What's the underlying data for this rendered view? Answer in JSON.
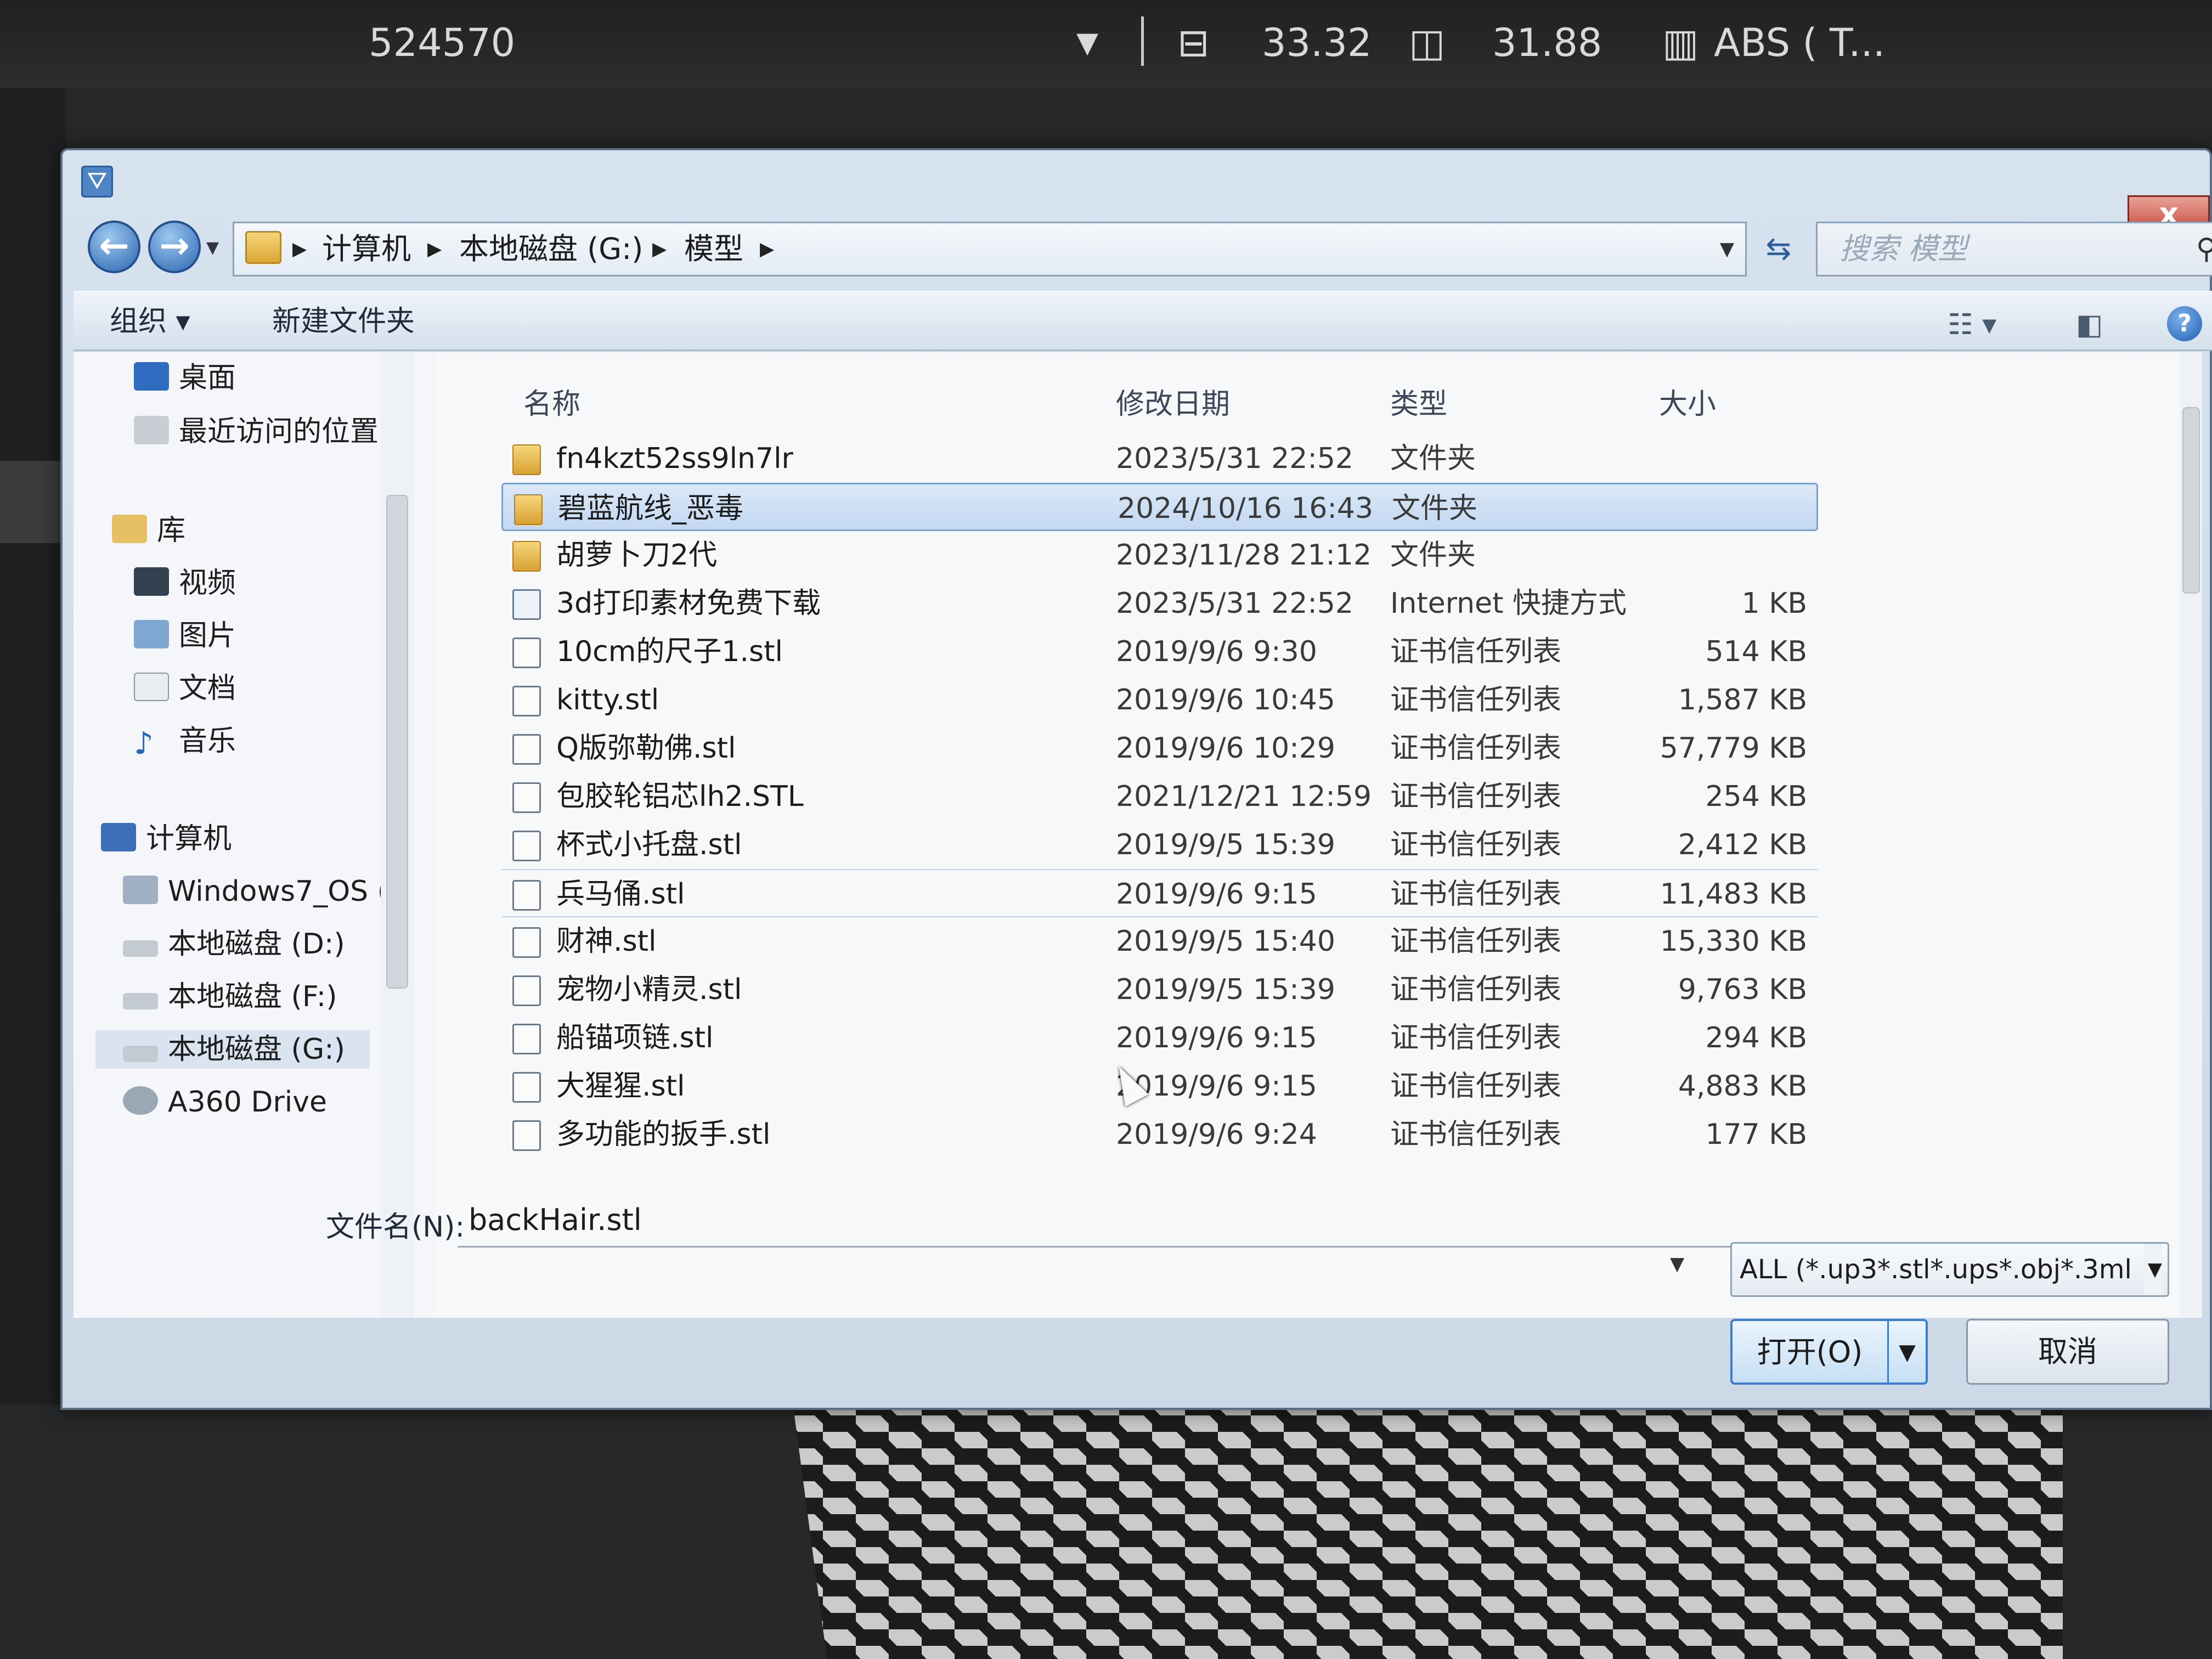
{
  "topbar": {
    "id_text": "524570",
    "dropdown_icon": "▼",
    "nozzle_temp": "33.32",
    "bed_temp": "31.88",
    "material": "ABS ( T..."
  },
  "dialog": {
    "title_icon": "filter-icon",
    "close_label": "x",
    "breadcrumb": [
      "计算机",
      "本地磁盘 (G:)",
      "模型"
    ],
    "search_placeholder": "搜索 模型",
    "toolbar": {
      "organize": "组织 ▾",
      "new_folder": "新建文件夹"
    },
    "nav": {
      "favorites": [
        "桌面",
        "最近访问的位置"
      ],
      "library_label": "库",
      "libraries": [
        "视频",
        "图片",
        "文档",
        "音乐"
      ],
      "computer_label": "计算机",
      "drives": [
        "Windows7_OS (",
        "本地磁盘 (D:)",
        "本地磁盘 (F:)",
        "本地磁盘 (G:)",
        "A360 Drive"
      ]
    },
    "columns": {
      "name": "名称",
      "date": "修改日期",
      "type": "类型",
      "size": "大小"
    },
    "files": [
      {
        "name": "fn4kzt52ss9ln7lr",
        "date": "2023/5/31 22:52",
        "type": "文件夹",
        "size": "",
        "kind": "folder"
      },
      {
        "name": "碧蓝航线_恶毒",
        "date": "2024/10/16 16:43",
        "type": "文件夹",
        "size": "",
        "kind": "folder"
      },
      {
        "name": "胡萝卜刀2代",
        "date": "2023/11/28 21:12",
        "type": "文件夹",
        "size": "",
        "kind": "folder"
      },
      {
        "name": "3d打印素材免费下载",
        "date": "2023/5/31 22:52",
        "type": "Internet 快捷方式",
        "size": "1 KB",
        "kind": "link"
      },
      {
        "name": "10cm的尺子1.stl",
        "date": "2019/9/6 9:30",
        "type": "证书信任列表",
        "size": "514 KB",
        "kind": "file"
      },
      {
        "name": "kitty.stl",
        "date": "2019/9/6 10:45",
        "type": "证书信任列表",
        "size": "1,587 KB",
        "kind": "file"
      },
      {
        "name": "Q版弥勒佛.stl",
        "date": "2019/9/6 10:29",
        "type": "证书信任列表",
        "size": "57,779 KB",
        "kind": "file"
      },
      {
        "name": "包胶轮铝芯lh2.STL",
        "date": "2021/12/21 12:59",
        "type": "证书信任列表",
        "size": "254 KB",
        "kind": "file"
      },
      {
        "name": "杯式小托盘.stl",
        "date": "2019/9/5 15:39",
        "type": "证书信任列表",
        "size": "2,412 KB",
        "kind": "file"
      },
      {
        "name": "兵马俑.stl",
        "date": "2019/9/6 9:15",
        "type": "证书信任列表",
        "size": "11,483 KB",
        "kind": "file"
      },
      {
        "name": "财神.stl",
        "date": "2019/9/5 15:40",
        "type": "证书信任列表",
        "size": "15,330 KB",
        "kind": "file"
      },
      {
        "name": "宠物小精灵.stl",
        "date": "2019/9/5 15:39",
        "type": "证书信任列表",
        "size": "9,763 KB",
        "kind": "file"
      },
      {
        "name": "船锚项链.stl",
        "date": "2019/9/6 9:15",
        "type": "证书信任列表",
        "size": "294 KB",
        "kind": "file"
      },
      {
        "name": "大猩猩.stl",
        "date": "2019/9/6 9:15",
        "type": "证书信任列表",
        "size": "4,883 KB",
        "kind": "file"
      },
      {
        "name": "多功能的扳手.stl",
        "date": "2019/9/6 9:24",
        "type": "证书信任列表",
        "size": "177 KB",
        "kind": "file"
      }
    ],
    "selected_index": 1,
    "filename_label": "文件名(N):",
    "filename_value": "backHair.stl",
    "filter_value": "ALL (*.up3*.stl*.ups*.obj*.3ml",
    "open_label": "打开(O)",
    "cancel_label": "取消"
  }
}
